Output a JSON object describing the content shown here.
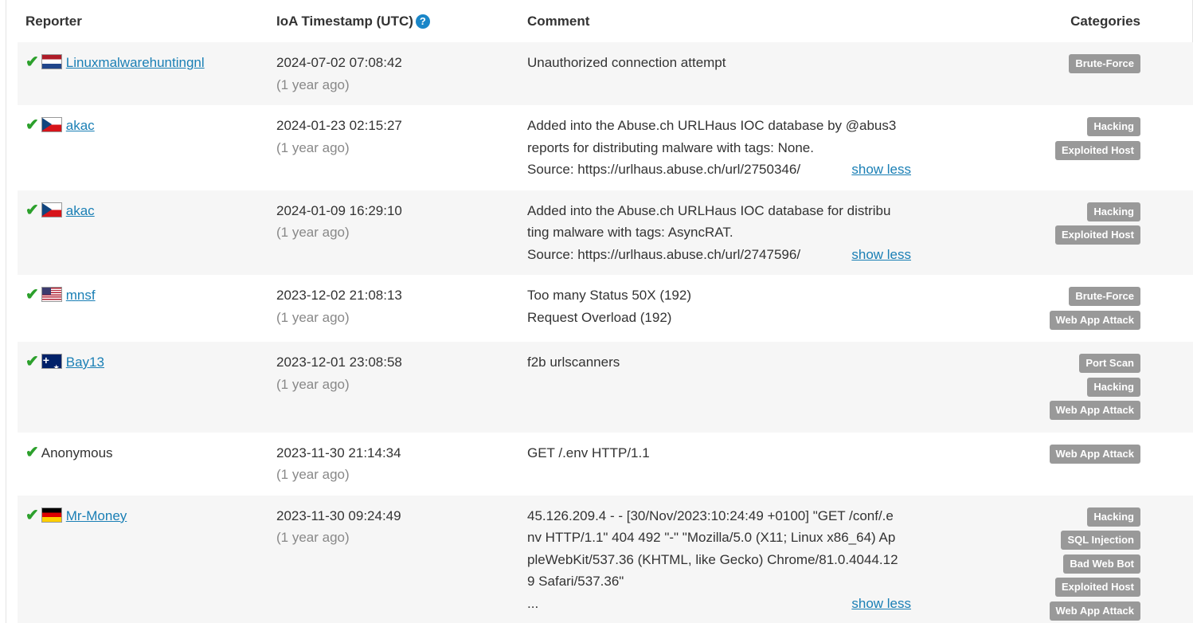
{
  "headers": {
    "reporter": "Reporter",
    "timestamp": "IoA Timestamp (UTC)",
    "comment": "Comment",
    "categories": "Categories"
  },
  "help_icon": "question-circle-icon",
  "colors": {
    "link": "#1a7fb5",
    "badge": "#999999",
    "check": "#2ca02c",
    "help": "#1a86c8"
  },
  "reports": [
    {
      "reporter": "Linuxmalwarehuntingnl",
      "flag": "netherlands",
      "timestamp": "2024-07-02 07:08:42",
      "ago": "(1 year ago)",
      "comment_lines": [
        "Unauthorized connection attempt"
      ],
      "show_less": "",
      "categories": [
        "Brute-Force"
      ]
    },
    {
      "reporter": "akac",
      "flag": "czech-republic",
      "timestamp": "2024-01-23 02:15:27",
      "ago": "(1 year ago)",
      "comment_lines": [
        "Added into the Abuse.ch URLHaus IOC database by @abus3",
        "reports for distributing malware with tags: None.",
        "Source: https://urlhaus.abuse.ch/url/2750346/"
      ],
      "show_less": "show less",
      "categories": [
        "Hacking",
        "Exploited Host"
      ]
    },
    {
      "reporter": "akac",
      "flag": "czech-republic",
      "timestamp": "2024-01-09 16:29:10",
      "ago": "(1 year ago)",
      "comment_lines": [
        "Added into the Abuse.ch URLHaus IOC database for distribu",
        "ting malware with tags: AsyncRAT.",
        "Source: https://urlhaus.abuse.ch/url/2747596/"
      ],
      "show_less": "show less",
      "categories": [
        "Hacking",
        "Exploited Host"
      ]
    },
    {
      "reporter": "mnsf",
      "flag": "united-states",
      "timestamp": "2023-12-02 21:08:13",
      "ago": "(1 year ago)",
      "comment_lines": [
        "Too many Status 50X (192)",
        "Request Overload (192)"
      ],
      "show_less": "",
      "categories": [
        "Brute-Force",
        "Web App Attack"
      ]
    },
    {
      "reporter": "Bay13",
      "flag": "australia",
      "timestamp": "2023-12-01 23:08:58",
      "ago": "(1 year ago)",
      "comment_lines": [
        "f2b urlscanners"
      ],
      "show_less": "",
      "categories": [
        "Port Scan",
        "Hacking",
        "Web App Attack"
      ]
    },
    {
      "reporter": "Anonymous",
      "flag": "",
      "timestamp": "2023-11-30 21:14:34",
      "ago": "(1 year ago)",
      "comment_lines": [
        "GET /.env HTTP/1.1"
      ],
      "show_less": "",
      "categories": [
        "Web App Attack"
      ]
    },
    {
      "reporter": "Mr-Money",
      "flag": "germany",
      "timestamp": "2023-11-30 09:24:49",
      "ago": "(1 year ago)",
      "comment_lines": [
        "45.126.209.4 - - [30/Nov/2023:10:24:49 +0100] \"GET /conf/.e",
        "nv HTTP/1.1\" 404 492 \"-\" \"Mozilla/5.0 (X11; Linux x86_64) Ap",
        "pleWebKit/537.36 (KHTML, like Gecko) Chrome/81.0.4044.12",
        "9 Safari/537.36\"",
        "..."
      ],
      "show_less": "show less",
      "categories": [
        "Hacking",
        "SQL Injection",
        "Bad Web Bot",
        "Exploited Host",
        "Web App Attack"
      ]
    }
  ]
}
